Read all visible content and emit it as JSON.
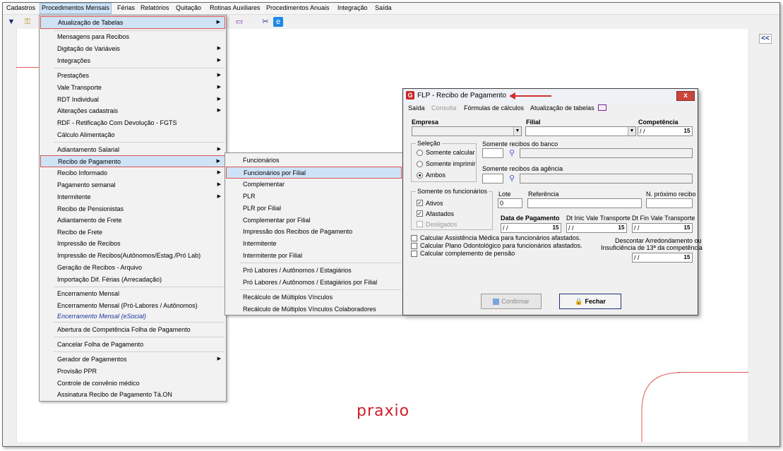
{
  "menubar": {
    "items": [
      "Cadastros",
      "Procedimentos Mensais",
      "Férias",
      "Relatórios",
      "Quitação",
      "Rotinas Auxiliares",
      "Procedimentos Anuais",
      "Integração",
      "Saída"
    ]
  },
  "main_menu": {
    "items": [
      "Atualização de Tabelas",
      "Mensagens para Recibos",
      "Digitação de Variáveis",
      "Integrações",
      "Prestações",
      "Vale Transporte",
      "RDT Individual",
      "Alterações cadastrais",
      "RDF - Retificação Com Devolução - FGTS",
      "Cálculo Alimentação",
      "Adiantamento Salarial",
      "Recibo de Pagamento",
      "Recibo Informado",
      "Pagamento semanal",
      "Intermitente",
      "Recibo de Pensionistas",
      "Adiantamento de Frete",
      "Recibo de Frete",
      "Impressão de Recibos",
      "Impressão de Recibos(Autônomos/Estag./Pró Lab)",
      "Geração de Recibos - Arquivo",
      "Importação Dif. Férias (Arrecadação)",
      "Encerramento Mensal",
      "Encerramento Mensal (Pró-Labores / Autônomos)",
      "Encerramento Mensal (eSocial)",
      "Abertura de Competência Folha de Pagamento",
      "Cancelar Folha de Pagamento",
      "Gerador de Pagamentos",
      "Provisão PPR",
      "Controle de convênio médico",
      "Assinatura Recibo de Pagamento Tá.ON"
    ]
  },
  "submenu": {
    "items": [
      "Funcionários",
      "Funcionários por Filial",
      "Complementar",
      "PLR",
      "PLR por Filial",
      "Complementar por Filial",
      "Impressão dos Recibos de Pagamento",
      "Intermitente",
      "Intermitente por Filial",
      "Pró Labores / Autônomos / Estagiários",
      "Pró Labores / Autônomos / Estagiários por Filial",
      "Recálculo de Múltiplos Vínculos",
      "Recálculo de Múltiplos Vínculos Colaboradores"
    ]
  },
  "dialog": {
    "title": "FLP - Recibo de Pagamento",
    "close": "x",
    "menu": [
      "Saída",
      "Consulta",
      "Fórmulas de cálculos",
      "Atualização de tabelas"
    ],
    "empresa_label": "Empresa",
    "filial_label": "Filial",
    "competencia_label": "Competência",
    "competencia_value": " / /",
    "selecao_title": "Seleção",
    "selecao_options": [
      "Somente calcular",
      "Somente imprimir",
      "Ambos"
    ],
    "banco_label": "Somente recibos do banco",
    "agencia_label": "Somente recibos da agência",
    "funcionarios_title": "Somente os funcionários",
    "funcionarios_options": [
      "Ativos",
      "Afastados",
      "Desligados"
    ],
    "lote_label": "Lote",
    "lote_value": "0",
    "referencia_label": "Referência",
    "proximo_recibo_label": "N. próximo recibo",
    "data_pagamento_label": "Data de Pagamento",
    "data_pagamento_value": " / /",
    "dt_inic_label": "Dt Inic Vale Transporte",
    "dt_inic_value": " / /",
    "dt_fin_label": "Dt Fin Vale Transporte",
    "dt_fin_value": " / /",
    "check_assist": "Calcular Assistência Médica para funcionários afastados.",
    "check_odonto": "Calcular Plano Odontológico para funcionários afastados.",
    "check_pensao": "Calcular complemento de pensão",
    "descontar_line1": "Descontar Arredondamento ou",
    "descontar_line2": "Insuficiência de 13ª da competência",
    "descontar_value": " / /",
    "confirm_label": "Confirmar",
    "fechar_label": "Fechar",
    "cal_glyph": "15"
  },
  "brand": "praxio",
  "collapse": "<<"
}
